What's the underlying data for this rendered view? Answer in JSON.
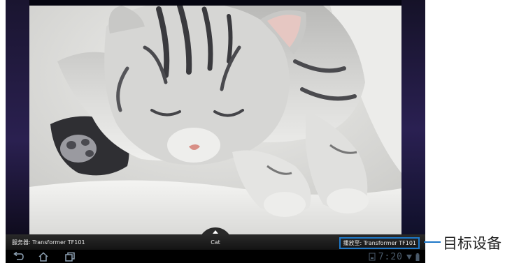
{
  "photo": {
    "subject": "Cat"
  },
  "info_bar": {
    "server_label": "服务器: Transformer TF101",
    "title": "Cat",
    "play_to_label": "播放至: Transformer TF101"
  },
  "nav_bar": {
    "buttons": [
      "back-icon",
      "home-icon",
      "recent-apps-icon"
    ]
  },
  "status": {
    "time": "7:20",
    "icons": [
      "storage-icon",
      "wifi-icon",
      "battery-icon"
    ]
  },
  "annotation": {
    "label": "目标设备"
  },
  "colors": {
    "highlight": "#1e78c8",
    "bar": "#1a1a1a",
    "clock": "#4a5a6a"
  }
}
